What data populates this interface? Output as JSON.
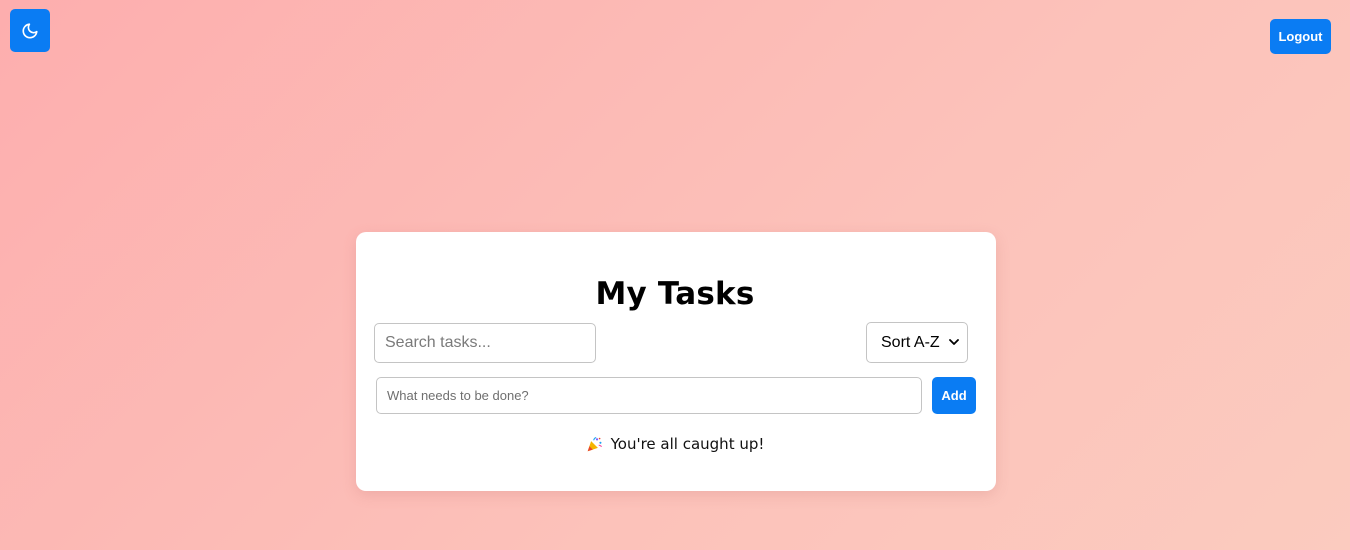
{
  "header": {
    "theme_toggle_icon": "moon-icon",
    "logout_label": "Logout"
  },
  "colors": {
    "accent": "#0a7cf3",
    "background_start": "#fdaeae",
    "background_end": "#fbcbbf",
    "card": "#ffffff"
  },
  "tasks": {
    "title": "My Tasks",
    "search": {
      "placeholder": "Search tasks...",
      "value": ""
    },
    "sort": {
      "selected": "Sort A-Z"
    },
    "new_task": {
      "placeholder": "What needs to be done?",
      "value": ""
    },
    "add_label": "Add",
    "empty_icon": "party-popper-icon",
    "empty_message": "You're all caught up!"
  }
}
